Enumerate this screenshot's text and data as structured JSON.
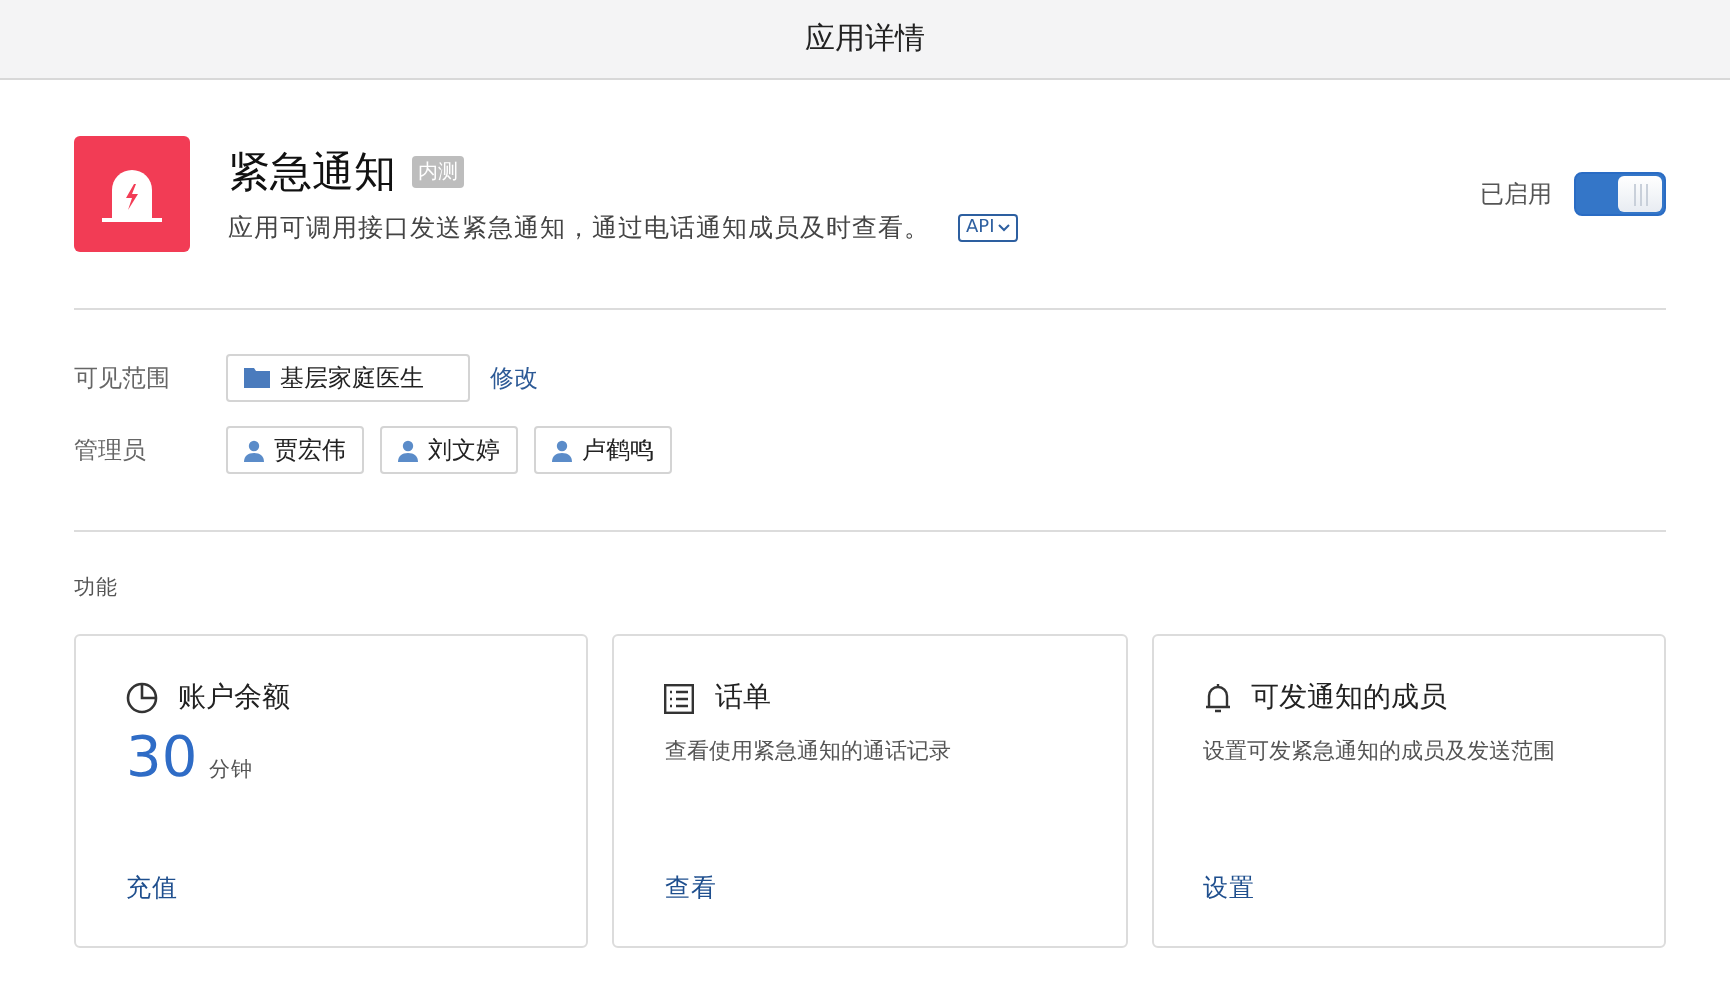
{
  "window": {
    "title": "应用详情"
  },
  "app": {
    "name": "紧急通知",
    "badge": "内测",
    "description": "应用可调用接口发送紧急通知，通过电话通知成员及时查看。",
    "api_label": "API",
    "status_label": "已启用",
    "enabled": true
  },
  "visibility": {
    "label": "可见范围",
    "scope": "基层家庭医生",
    "edit_link": "修改"
  },
  "admins": {
    "label": "管理员",
    "people": [
      "贾宏伟",
      "刘文婷",
      "卢鹤鸣"
    ]
  },
  "features": {
    "label": "功能",
    "cards": [
      {
        "kind": "balance",
        "title": "账户余额",
        "amount": "30",
        "unit": "分钟",
        "action": "充值"
      },
      {
        "kind": "records",
        "title": "话单",
        "description": "查看使用紧急通知的通话记录",
        "action": "查看"
      },
      {
        "kind": "members",
        "title": "可发通知的成员",
        "description": "设置可发紧急通知的成员及发送范围",
        "action": "设置"
      }
    ]
  }
}
